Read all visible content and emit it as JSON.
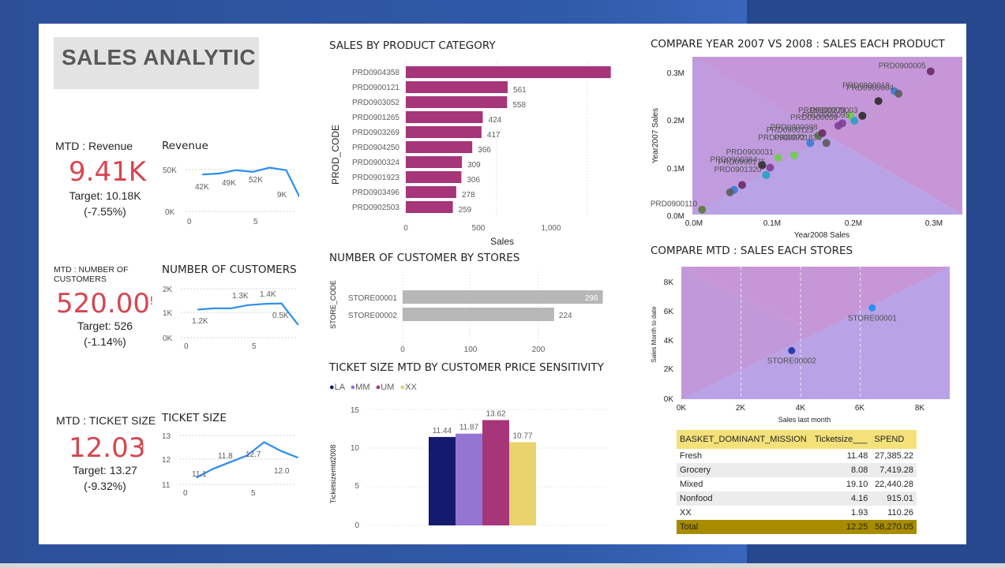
{
  "dashboard": {
    "title": "SALES ANALYTIC"
  },
  "colors": {
    "accent_red": "#d64550",
    "magenta": "#a6357a",
    "line_blue": "#2b8ef0",
    "bar_gray": "#b7b7b7",
    "navy": "#141b6e",
    "purple": "#9575d2",
    "yellow": "#e8d36c",
    "table_header": "#f4e17a",
    "table_total": "#a78c00"
  },
  "kpis": [
    {
      "label": "MTD : Revenue",
      "value": "9.41K",
      "target": "Target: 10.18K",
      "delta": "(-7.55%)"
    },
    {
      "label": "MTD : NUMBER OF CUSTOMERS",
      "value": "520.00",
      "target": "Target: 526",
      "delta": "(-1.14%)"
    },
    {
      "label": "MTD : TICKET SIZE",
      "value": "12.03",
      "target": "Target: 13.27",
      "delta": "(-9.32%)"
    }
  ],
  "chart_data": [
    {
      "id": "revenue",
      "type": "line",
      "title": "Revenue",
      "x": [
        1,
        2,
        3,
        4,
        5,
        6,
        7
      ],
      "y": [
        44,
        45,
        49,
        47,
        52,
        49,
        9
      ],
      "data_labels": [
        "42K",
        "49K",
        "52K",
        "9K"
      ],
      "yticks": [
        "50K",
        "0K"
      ],
      "xticks": [
        "0",
        "5"
      ],
      "xlim": [
        0,
        8
      ],
      "ylim": [
        0,
        60
      ]
    },
    {
      "id": "customers",
      "type": "line",
      "title": "NUMBER OF CUSTOMERS",
      "x": [
        1,
        2,
        3,
        4,
        5,
        6,
        7
      ],
      "y": [
        1.15,
        1.2,
        1.2,
        1.33,
        1.38,
        1.4,
        0.52
      ],
      "data_labels": [
        "1.2K",
        "1.3K",
        "1.4K",
        "0.5K"
      ],
      "yticks": [
        "2K",
        "1K",
        "0K"
      ],
      "xticks": [
        "0",
        "5"
      ],
      "xlim": [
        0,
        8
      ],
      "ylim": [
        0,
        2
      ]
    },
    {
      "id": "ticket",
      "type": "line",
      "title": "TICKET SIZE",
      "x": [
        1,
        2,
        3,
        4,
        5,
        6,
        7
      ],
      "y": [
        11.1,
        11.5,
        11.8,
        12.1,
        12.7,
        12.3,
        12.0
      ],
      "data_labels": [
        "11.1",
        "11.8",
        "12.7",
        "12.0"
      ],
      "yticks": [
        "13",
        "12",
        "11"
      ],
      "xticks": [
        "0",
        "5"
      ],
      "xlim": [
        0,
        8
      ],
      "ylim": [
        10.8,
        13
      ]
    },
    {
      "id": "category",
      "type": "bar",
      "orientation": "horizontal",
      "title": "SALES BY PRODUCT CATEGORY",
      "categories": [
        "PRD0904358",
        "PRD0900121",
        "PRD0903052",
        "PRD0901265",
        "PRD0903269",
        "PRD0904250",
        "PRD0900324",
        "PRD0901923",
        "PRD0903496",
        "PRD0902503"
      ],
      "values": [
        1129,
        561,
        558,
        424,
        417,
        366,
        309,
        306,
        278,
        259
      ],
      "xlabel": "Sales",
      "ylabel": "PROD_CODE",
      "xticks": [
        "0",
        "500",
        "1,000"
      ],
      "xlim": [
        0,
        1200
      ]
    },
    {
      "id": "stores",
      "type": "bar",
      "orientation": "horizontal",
      "title": "NUMBER OF CUSTOMER BY STORES",
      "categories": [
        "STORE00001",
        "STORE00002"
      ],
      "values": [
        296,
        224
      ],
      "ylabel": "STORE_CODE",
      "xticks": [
        "0",
        "100",
        "200"
      ],
      "xlim": [
        0,
        300
      ]
    },
    {
      "id": "sensitivity",
      "type": "bar",
      "title": "TICKET SIZE MTD BY CUSTOMER PRICE SENSITIVITY",
      "categories": [
        "LA",
        "MM",
        "UM",
        "XX"
      ],
      "values": [
        11.44,
        11.87,
        13.62,
        10.77
      ],
      "series": [
        {
          "name": "LA"
        },
        {
          "name": "MM"
        },
        {
          "name": "UM"
        },
        {
          "name": "XX"
        }
      ],
      "ylabel": "Ticketsizemtd2008",
      "yticks": [
        "15",
        "10",
        "5",
        "0"
      ],
      "ylim": [
        0,
        15
      ],
      "legend": "top-left"
    },
    {
      "id": "compare_products",
      "type": "scatter",
      "title": "COMPARE YEAR 2007 VS 2008 : SALES EACH PRODUCT",
      "xlabel": "Year2008 Sales",
      "ylabel": "Year2007 Sales",
      "xticks": [
        "0.0M",
        "0.1M",
        "0.2M",
        "0.3M"
      ],
      "yticks": [
        "0.3M",
        "0.2M",
        "0.1M",
        "0.0M"
      ],
      "xlim": [
        0,
        0.31
      ],
      "ylim": [
        0,
        0.31
      ],
      "points": [
        {
          "x": 0.295,
          "y": 0.29,
          "label": "PRD0900005"
        },
        {
          "x": 0.25,
          "y": 0.25,
          "label": "PRD0900019"
        },
        {
          "x": 0.255,
          "y": 0.245,
          "label": "PRD0900004"
        },
        {
          "x": 0.195,
          "y": 0.2,
          "label": "PRD0900279"
        },
        {
          "x": 0.21,
          "y": 0.2,
          "label": "PRD0900003"
        },
        {
          "x": 0.185,
          "y": 0.185,
          "label": "PRD0900059"
        },
        {
          "x": 0.2,
          "y": 0.19,
          "label": "PRD0900095"
        },
        {
          "x": 0.155,
          "y": 0.16,
          "label": "PRD0900123"
        },
        {
          "x": 0.16,
          "y": 0.165,
          "label": "PRD0900098"
        },
        {
          "x": 0.145,
          "y": 0.145,
          "label": "PRD0900072"
        },
        {
          "x": 0.165,
          "y": 0.145,
          "label": "PRD0901820"
        },
        {
          "x": 0.105,
          "y": 0.115,
          "label": "PRD0900031"
        },
        {
          "x": 0.085,
          "y": 0.1,
          "label": "PRD0900364"
        },
        {
          "x": 0.095,
          "y": 0.095,
          "label": "PRD0900175"
        },
        {
          "x": 0.09,
          "y": 0.08,
          "label": "PRD0901320"
        },
        {
          "x": 0.01,
          "y": 0.01,
          "label": "PRD0900110"
        },
        {
          "x": 0.06,
          "y": 0.06,
          "label": ""
        },
        {
          "x": 0.05,
          "y": 0.05,
          "label": ""
        },
        {
          "x": 0.045,
          "y": 0.045,
          "label": ""
        },
        {
          "x": 0.125,
          "y": 0.12,
          "label": ""
        },
        {
          "x": 0.23,
          "y": 0.23,
          "label": ""
        },
        {
          "x": 0.18,
          "y": 0.18,
          "label": ""
        }
      ]
    },
    {
      "id": "compare_stores",
      "type": "scatter",
      "title": "COMPARE MTD : SALES EACH STORES",
      "xlabel": "Sales last month",
      "ylabel": "Sales Month to date",
      "xticks": [
        "0K",
        "2K",
        "4K",
        "6K",
        "8K"
      ],
      "yticks": [
        "8K",
        "6K",
        "4K",
        "2K",
        "0K"
      ],
      "xlim": [
        0,
        9000
      ],
      "ylim": [
        0,
        9000
      ],
      "points": [
        {
          "x": 6400,
          "y": 6200,
          "label": "STORE00001"
        },
        {
          "x": 3700,
          "y": 3300,
          "label": "STORE00002"
        }
      ]
    }
  ],
  "table": {
    "headers": [
      "BASKET_DOMINANT_MISSION",
      "Ticketsize___",
      "SPEND"
    ],
    "rows": [
      [
        "Fresh",
        "11.48",
        "27,385.22"
      ],
      [
        "Grocery",
        "8.08",
        "7,419.28"
      ],
      [
        "Mixed",
        "19.10",
        "22,440.28"
      ],
      [
        "Nonfood",
        "4.16",
        "915.01"
      ],
      [
        "XX",
        "1.93",
        "110.26"
      ]
    ],
    "total": [
      "Total",
      "12.25",
      "58,270.05"
    ]
  }
}
